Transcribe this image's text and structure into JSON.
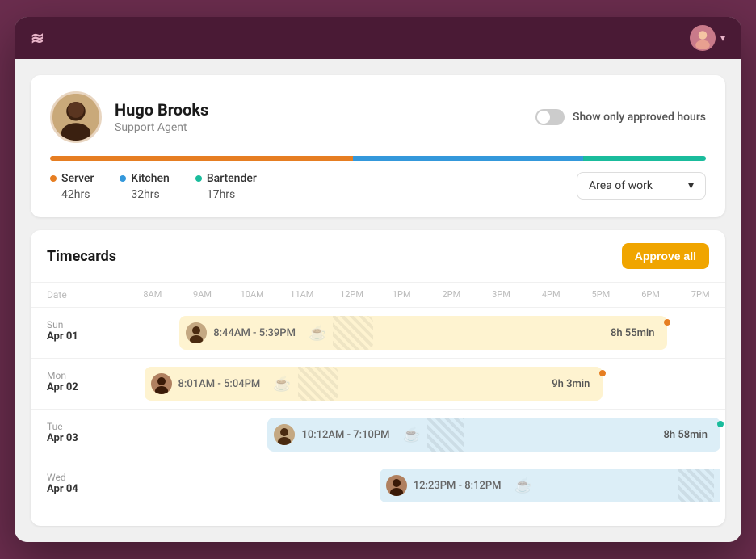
{
  "app": {
    "logo": "≋",
    "topbar_bg": "#4a1a35"
  },
  "profile": {
    "name": "Hugo Brooks",
    "role": "Support Agent",
    "toggle_label": "Show only approved hours",
    "stats": [
      {
        "label": "Server",
        "hours": "42hrs",
        "color_class": "dot-server"
      },
      {
        "label": "Kitchen",
        "hours": "32hrs",
        "color_class": "dot-kitchen"
      },
      {
        "label": "Bartender",
        "hours": "17hrs",
        "color_class": "dot-bartender"
      }
    ],
    "area_of_work_label": "Area of work"
  },
  "timecards": {
    "title": "Timecards",
    "approve_all_label": "Approve all",
    "time_headers": [
      "8AM",
      "9AM",
      "10AM",
      "11AM",
      "12PM",
      "1PM",
      "2PM",
      "3PM",
      "4PM",
      "5PM",
      "6PM",
      "7PM"
    ],
    "date_col_label": "Date",
    "rows": [
      {
        "day": "Sun",
        "date": "Apr 01",
        "time_range": "8:44AM - 5:39PM",
        "duration": "8h 55min",
        "bar_type": "yellow",
        "dot_color": "orange",
        "left_offset": "12%",
        "bar_width": "80%"
      },
      {
        "day": "Mon",
        "date": "Apr 02",
        "time_range": "8:01AM - 5:04PM",
        "duration": "9h 3min",
        "bar_type": "yellow",
        "dot_color": "orange2",
        "left_offset": "8%",
        "bar_width": "75%"
      },
      {
        "day": "Tue",
        "date": "Apr 03",
        "time_range": "10:12AM - 7:10PM",
        "duration": "8h 58min",
        "bar_type": "blue",
        "dot_color": "green",
        "left_offset": "27%",
        "bar_width": "88%"
      },
      {
        "day": "Wed",
        "date": "Apr 04",
        "time_range": "12:23PM - 8:12PM",
        "duration": "",
        "bar_type": "blue",
        "dot_color": "teal",
        "left_offset": "45%",
        "bar_width": "85%"
      }
    ]
  }
}
